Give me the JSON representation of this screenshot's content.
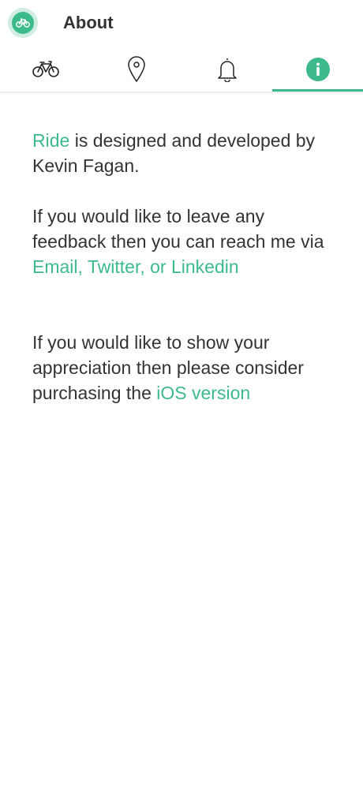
{
  "header": {
    "title": "About",
    "logo_icon": "bike-icon"
  },
  "tabs": [
    {
      "name": "bike-tab",
      "icon": "bike-icon",
      "active": false
    },
    {
      "name": "location-tab",
      "icon": "map-pin-icon",
      "active": false
    },
    {
      "name": "notifications-tab",
      "icon": "bell-icon",
      "active": false
    },
    {
      "name": "about-tab",
      "icon": "info-icon",
      "active": true
    }
  ],
  "about": {
    "p1_link": "Ride",
    "p1_text": " is designed and developed by Kevin Fagan.",
    "p2_text": "If you would like to leave any feedback then you can reach me via ",
    "p2_link": "Email, Twitter, or Linkedin",
    "p3_text": "If you would like to show your appreciation then please consider purchasing the ",
    "p3_link": "iOS version"
  },
  "colors": {
    "accent": "#3dba8c",
    "text": "#333333",
    "logo_bg": "#cfeee1"
  }
}
